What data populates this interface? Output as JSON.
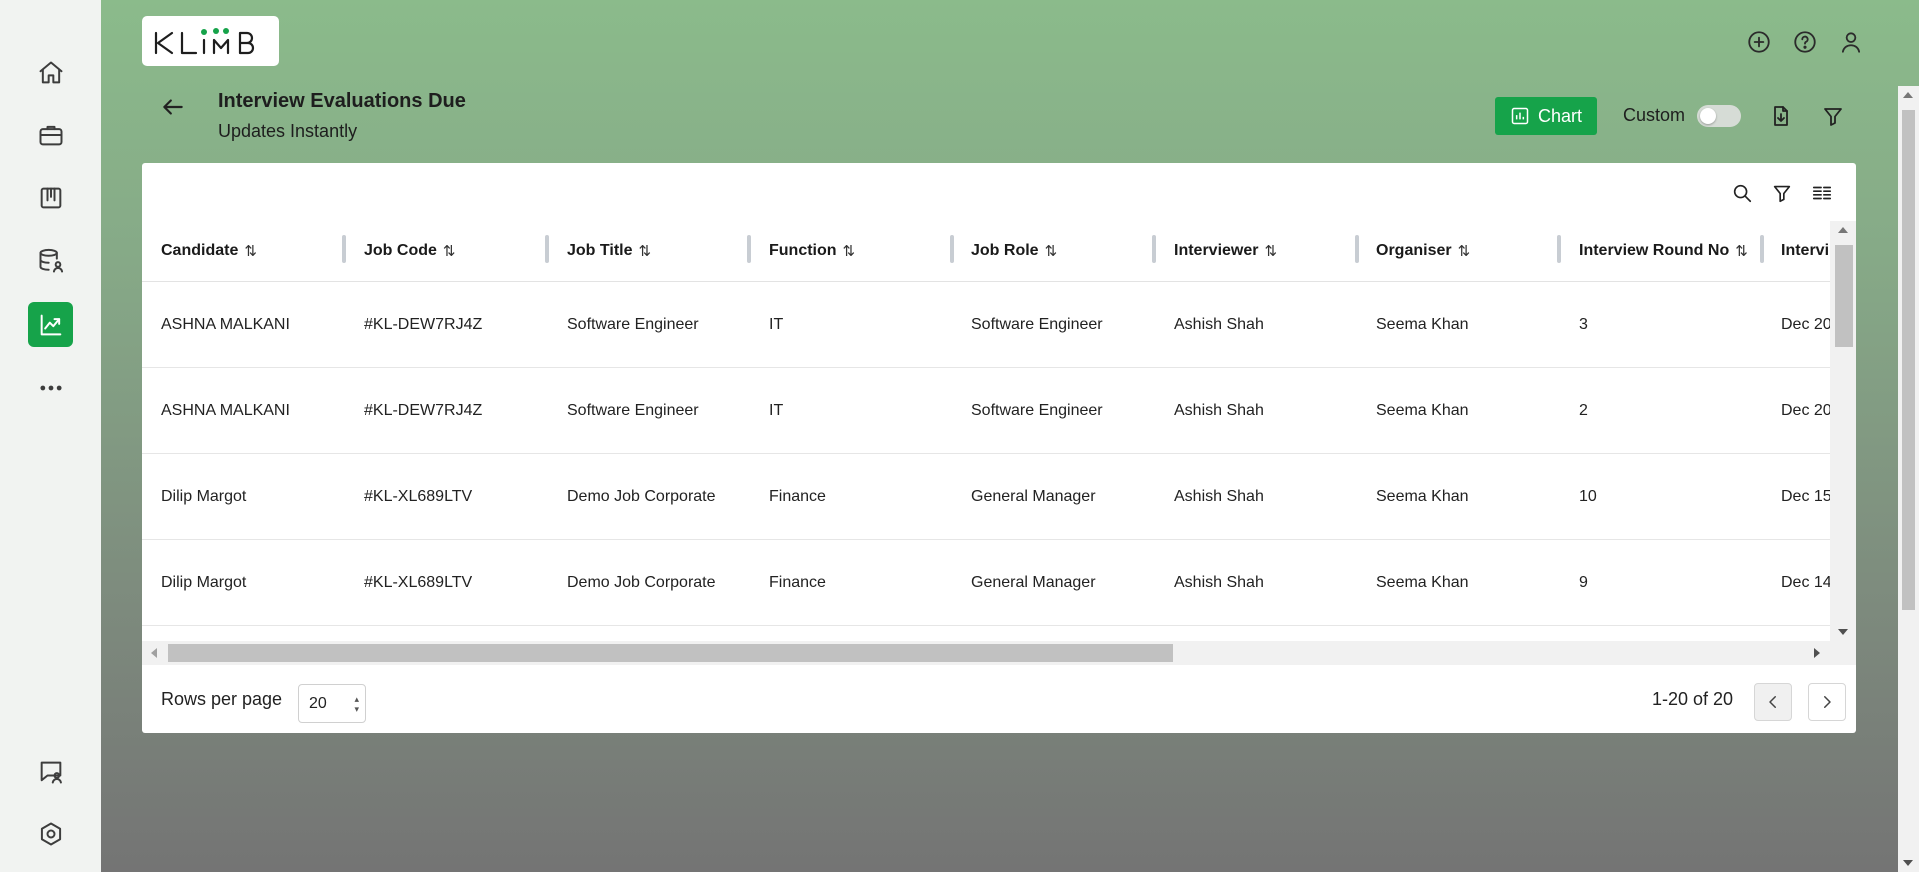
{
  "app": {
    "logo_text": "KLIMB",
    "accent": "#16a34a"
  },
  "sidebar": {
    "items": [
      {
        "icon": "home-icon",
        "active": false
      },
      {
        "icon": "briefcase-icon",
        "active": false
      },
      {
        "icon": "board-icon",
        "active": false
      },
      {
        "icon": "database-user-icon",
        "active": false
      },
      {
        "icon": "analytics-chart-icon",
        "active": true
      },
      {
        "icon": "more-icon",
        "active": false
      },
      {
        "icon": "chat-user-icon",
        "active": false
      },
      {
        "icon": "settings-hex-icon",
        "active": false
      }
    ]
  },
  "header": {
    "title": "Interview Evaluations Due",
    "subtitle": "Updates Instantly",
    "chart_label": "Chart",
    "custom_label": "Custom",
    "custom_toggle_on": false
  },
  "table": {
    "columns": [
      "Candidate",
      "Job Code",
      "Job Title",
      "Function",
      "Job Role",
      "Interviewer",
      "Organiser",
      "Interview Round No",
      "Intervi"
    ],
    "rows": [
      [
        "ASHNA MALKANI",
        "#KL-DEW7RJ4Z",
        "Software Engineer",
        "IT",
        "Software Engineer",
        "Ashish Shah",
        "Seema Khan",
        "3",
        "Dec 20"
      ],
      [
        "ASHNA MALKANI",
        "#KL-DEW7RJ4Z",
        "Software Engineer",
        "IT",
        "Software Engineer",
        "Ashish Shah",
        "Seema Khan",
        "2",
        "Dec 20"
      ],
      [
        "Dilip Margot",
        "#KL-XL689LTV",
        "Demo Job Corporate",
        "Finance",
        "General Manager",
        "Ashish Shah",
        "Seema Khan",
        "10",
        "Dec 15"
      ],
      [
        "Dilip Margot",
        "#KL-XL689LTV",
        "Demo Job Corporate",
        "Finance",
        "General Manager",
        "Ashish Shah",
        "Seema Khan",
        "9",
        "Dec 14"
      ],
      [
        "",
        "",
        "",
        "",
        "",
        "",
        "",
        "",
        ""
      ]
    ]
  },
  "footer": {
    "rows_per_page_label": "Rows per page",
    "rows_per_page_value": "20",
    "range_text": "1-20 of 20"
  }
}
